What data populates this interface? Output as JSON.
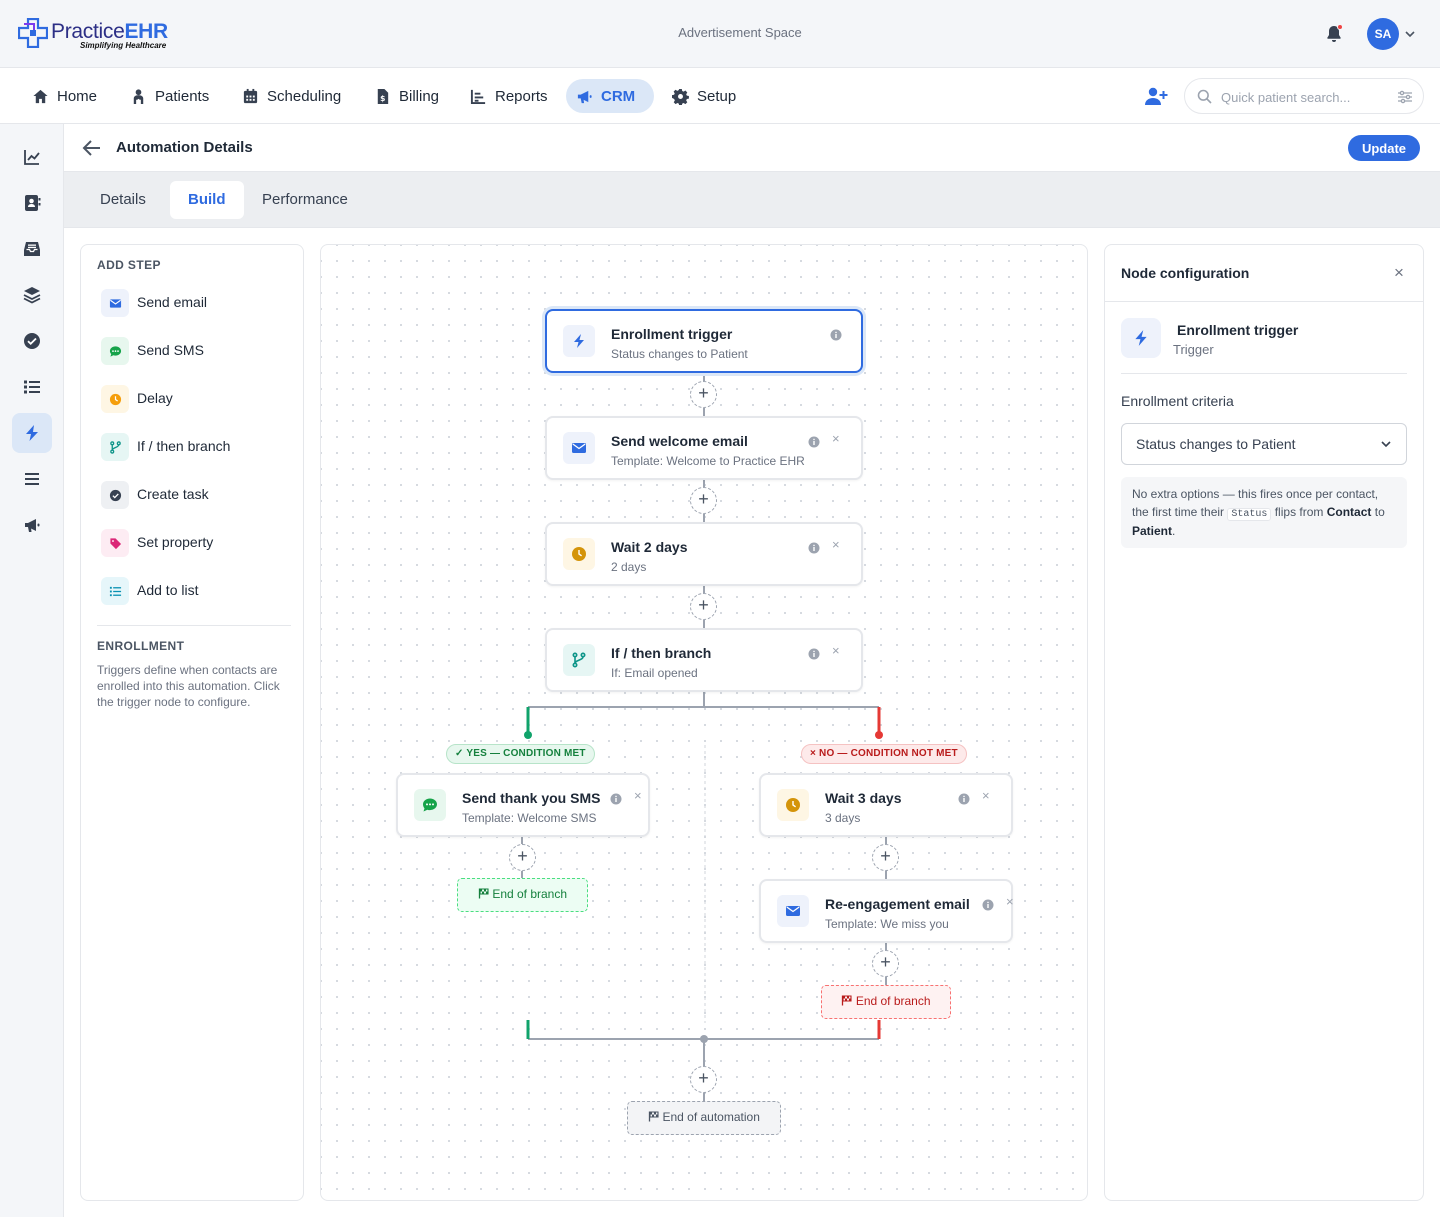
{
  "brand": {
    "name_part1": "Practice",
    "name_part2": "EHR",
    "tagline": "Simplifying Healthcare"
  },
  "header": {
    "ad_text": "Advertisement Space",
    "avatar_initials": "SA"
  },
  "nav": {
    "items": [
      {
        "label": "Home",
        "icon": "home-icon"
      },
      {
        "label": "Patients",
        "icon": "patients-icon"
      },
      {
        "label": "Scheduling",
        "icon": "calendar-icon"
      },
      {
        "label": "Billing",
        "icon": "billing-icon"
      },
      {
        "label": "Reports",
        "icon": "reports-icon"
      },
      {
        "label": "CRM",
        "icon": "megaphone-icon",
        "active": true
      },
      {
        "label": "Setup",
        "icon": "gear-icon"
      }
    ],
    "search_placeholder": "Quick patient search..."
  },
  "sidebar": {
    "icons": [
      "chart-line-icon",
      "contacts-icon",
      "inbox-icon",
      "layers-icon",
      "check-circle-icon",
      "list-icon",
      "lightning-icon",
      "menu-icon",
      "megaphone-icon"
    ],
    "active_index": 6
  },
  "page": {
    "title": "Automation Details",
    "update_label": "Update",
    "tabs": [
      {
        "label": "Details"
      },
      {
        "label": "Build",
        "active": true
      },
      {
        "label": "Performance"
      }
    ]
  },
  "left_panel": {
    "add_step_heading": "ADD STEP",
    "steps": [
      {
        "label": "Send email",
        "icon": "envelope-icon",
        "color": "#2f6be0"
      },
      {
        "label": "Send SMS",
        "icon": "chat-icon",
        "color": "#16a34a"
      },
      {
        "label": "Delay",
        "icon": "clock-icon",
        "color": "#f59e0b"
      },
      {
        "label": "If / then branch",
        "icon": "branch-icon",
        "color": "#0d9488"
      },
      {
        "label": "Create task",
        "icon": "check-circle-icon",
        "color": "#374151"
      },
      {
        "label": "Set property",
        "icon": "tag-icon",
        "color": "#db2777"
      },
      {
        "label": "Add to list",
        "icon": "list-icon",
        "color": "#0891b2"
      }
    ],
    "enrollment_heading": "ENROLLMENT",
    "enrollment_text": "Triggers define when contacts are enrolled into this automation. Click the trigger node to configure."
  },
  "flow": {
    "nodes": {
      "trigger": {
        "title": "Enrollment trigger",
        "subtitle": "Status changes to Patient"
      },
      "welcome": {
        "title": "Send welcome email",
        "subtitle": "Template: Welcome to Practice EHR"
      },
      "wait2": {
        "title": "Wait 2 days",
        "subtitle": "2 days"
      },
      "branch": {
        "title": "If / then branch",
        "subtitle": "If: Email opened"
      },
      "sms": {
        "title": "Send thank you SMS",
        "subtitle": "Template: Welcome SMS"
      },
      "wait3": {
        "title": "Wait 3 days",
        "subtitle": "3 days"
      },
      "reengage": {
        "title": "Re-engagement email",
        "subtitle": "Template: We miss you"
      }
    },
    "yes_label": "✓ YES — CONDITION MET",
    "no_label": "× NO — CONDITION NOT MET",
    "end_branch_yes": "End of branch",
    "end_branch_no": "End of branch",
    "end_automation": "End of automation",
    "colors": {
      "yes": "#10a36b",
      "no": "#e53935",
      "wire": "#9ca3af"
    }
  },
  "right_panel": {
    "title": "Node configuration",
    "node_title": "Enrollment trigger",
    "node_type": "Trigger",
    "criteria_label": "Enrollment criteria",
    "criteria_value": "Status changes to Patient",
    "note_part1": "No extra options — this fires once per contact, the first time their ",
    "note_code": "Status",
    "note_part2": " flips from ",
    "note_from": "Contact",
    "note_part3": " to ",
    "note_to": "Patient",
    "note_part4": "."
  }
}
